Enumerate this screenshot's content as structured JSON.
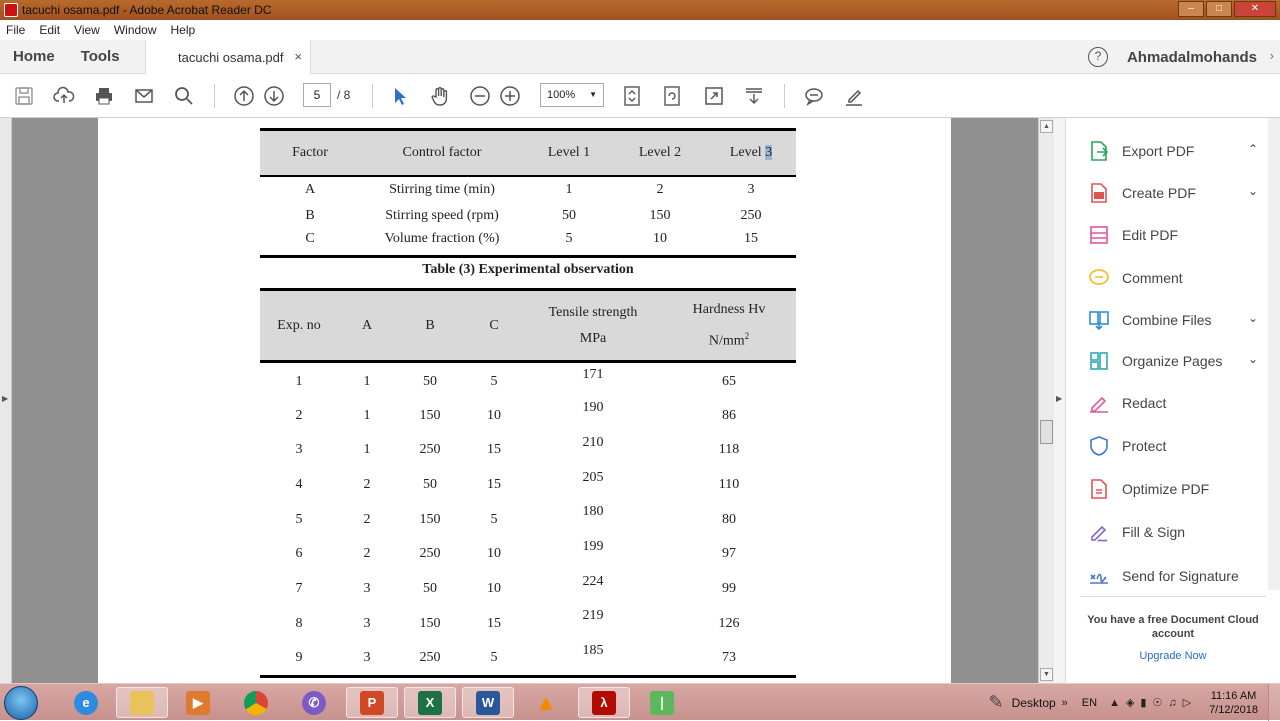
{
  "window": {
    "title": "tacuchi osama.pdf - Adobe Acrobat Reader DC",
    "buttons": [
      "–",
      "□",
      "✕"
    ]
  },
  "menu": [
    "File",
    "Edit",
    "View",
    "Window",
    "Help"
  ],
  "tabs": {
    "home": "Home",
    "tools": "Tools",
    "document": "tacuchi osama.pdf",
    "close": "×"
  },
  "user": {
    "help": "?",
    "name": "Ahmadalmohands",
    "more": "›"
  },
  "toolbar": {
    "page_current": "5",
    "page_total": "/ 8",
    "zoom": "100%",
    "zoom_arrow": "▼"
  },
  "table1": {
    "headers": [
      "Factor",
      "Control factor",
      "Level 1",
      "Level 2",
      "Level "
    ],
    "header_highlight": "3",
    "rows": [
      [
        "A",
        "Stirring time (min)",
        "1",
        "2",
        "3"
      ],
      [
        "B",
        "Stirring speed (rpm)",
        "50",
        "150",
        "250"
      ],
      [
        "C",
        "Volume fraction (%)",
        "5",
        "10",
        "15"
      ]
    ]
  },
  "table2_caption": "Table (3) Experimental observation",
  "table2": {
    "headers": [
      "Exp. no",
      "A",
      "B",
      "C",
      "Tensile strength",
      "MPa",
      "Hardness Hv",
      "N/mm",
      "2"
    ],
    "rows": [
      [
        "1",
        "1",
        "50",
        "5",
        "171",
        "65"
      ],
      [
        "2",
        "1",
        "150",
        "10",
        "190",
        "86"
      ],
      [
        "3",
        "1",
        "250",
        "15",
        "210",
        "118"
      ],
      [
        "4",
        "2",
        "50",
        "15",
        "205",
        "110"
      ],
      [
        "5",
        "2",
        "150",
        "5",
        "180",
        "80"
      ],
      [
        "6",
        "2",
        "250",
        "10",
        "199",
        "97"
      ],
      [
        "7",
        "3",
        "50",
        "10",
        "224",
        "99"
      ],
      [
        "8",
        "3",
        "150",
        "15",
        "219",
        "126"
      ],
      [
        "9",
        "3",
        "250",
        "5",
        "185",
        "73"
      ]
    ]
  },
  "tools_pane": {
    "items": [
      {
        "label": "Export PDF",
        "icon": "export-pdf-icon",
        "chevron": "⌃",
        "color": "#2aa65a"
      },
      {
        "label": "Create PDF",
        "icon": "create-pdf-icon",
        "chevron": "⌄",
        "color": "#e05353"
      },
      {
        "label": "Edit PDF",
        "icon": "edit-pdf-icon",
        "chevron": "",
        "color": "#e0579b"
      },
      {
        "label": "Comment",
        "icon": "comment-icon",
        "chevron": "",
        "color": "#f2c02f"
      },
      {
        "label": "Combine Files",
        "icon": "combine-files-icon",
        "chevron": "⌄",
        "color": "#2b8fd6"
      },
      {
        "label": "Organize Pages",
        "icon": "organize-pages-icon",
        "chevron": "⌄",
        "color": "#2fa8b5"
      },
      {
        "label": "Redact",
        "icon": "redact-icon",
        "chevron": "",
        "color": "#e05a9f"
      },
      {
        "label": "Protect",
        "icon": "protect-icon",
        "chevron": "",
        "color": "#3a79c9"
      },
      {
        "label": "Optimize PDF",
        "icon": "optimize-pdf-icon",
        "chevron": "",
        "color": "#e05353"
      },
      {
        "label": "Fill & Sign",
        "icon": "fill-sign-icon",
        "chevron": "",
        "color": "#8a63c9"
      },
      {
        "label": "Send for Signature",
        "icon": "send-signature-icon",
        "chevron": "",
        "color": "#4a75c9"
      }
    ],
    "cloud_message": "You have a free Document Cloud account",
    "upgrade": "Upgrade Now"
  },
  "taskbar": {
    "desktop": "Desktop",
    "chevrons": "»",
    "lang": "EN",
    "time": "11:16 AM",
    "date": "7/12/2018"
  }
}
